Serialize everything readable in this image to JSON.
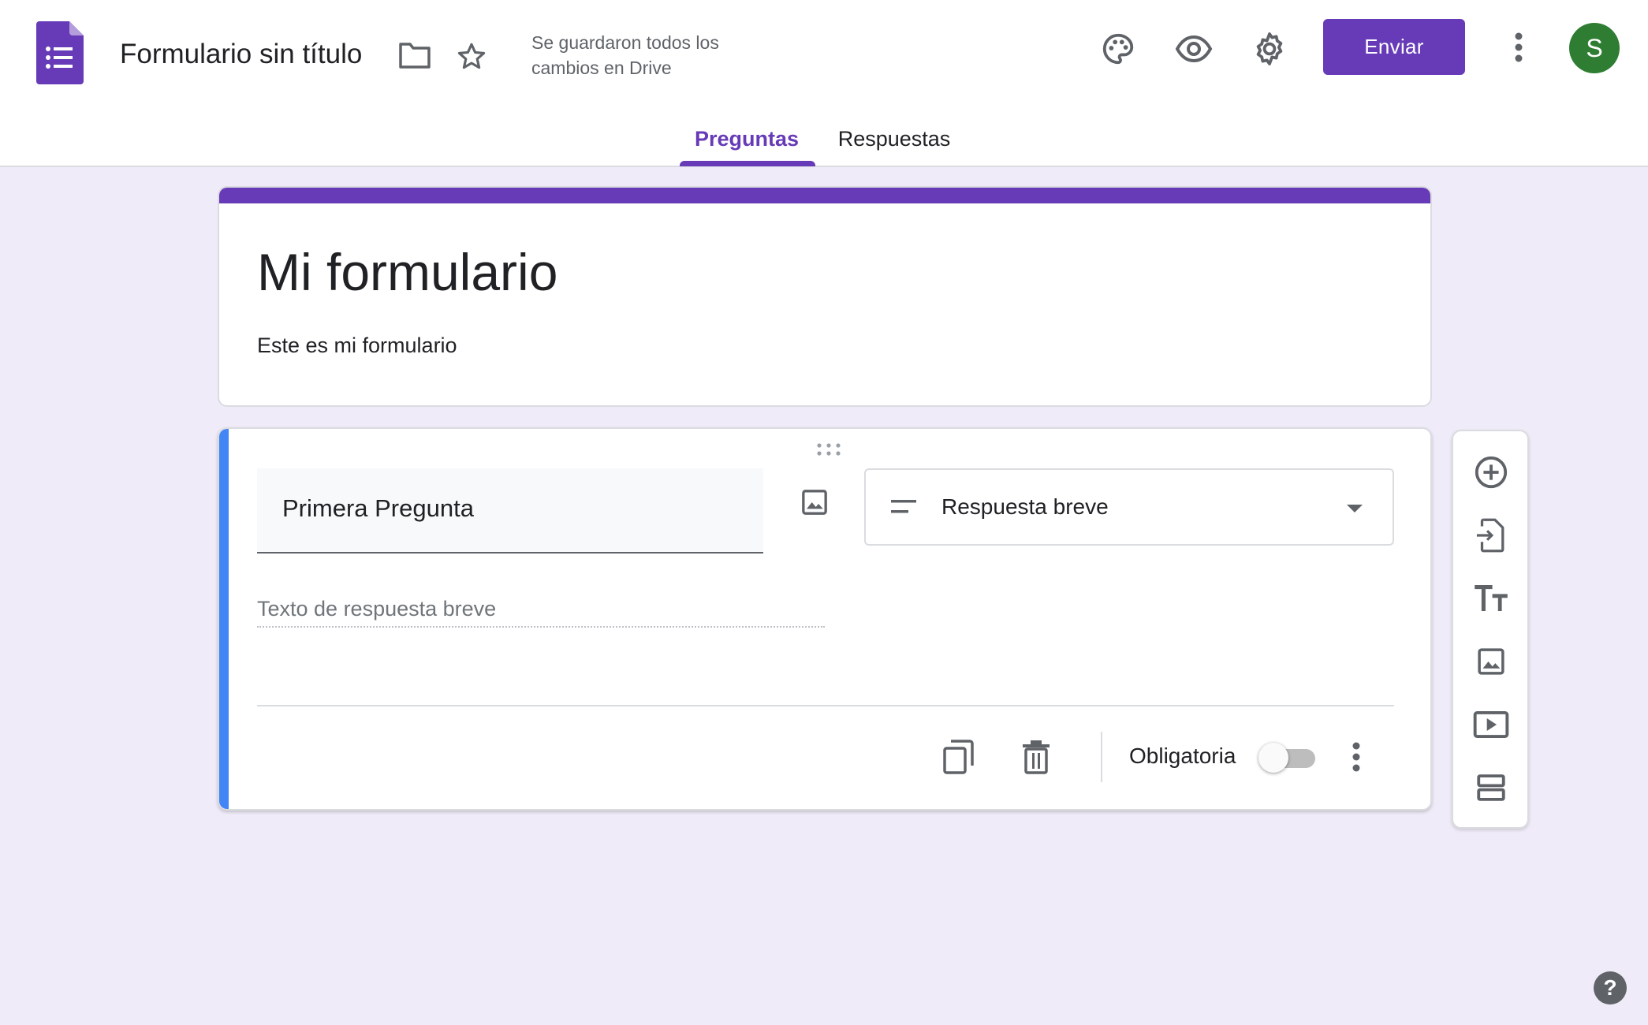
{
  "header": {
    "doc_title": "Formulario sin título",
    "saved_status": "Se guardaron todos los cambios en Drive",
    "send_label": "Enviar",
    "avatar_initial": "S",
    "icons": {
      "app": "google-forms-icon",
      "folder": "folder-icon",
      "star": "star-icon",
      "palette": "palette-icon",
      "preview": "eye-icon",
      "settings": "gear-icon",
      "more": "more-vert-icon"
    }
  },
  "tabs": [
    {
      "label": "Preguntas",
      "active": true
    },
    {
      "label": "Respuestas",
      "active": false
    }
  ],
  "form": {
    "title": "Mi formulario",
    "description": "Este es mi formulario"
  },
  "question": {
    "title": "Primera Pregunta",
    "type_label": "Respuesta breve",
    "answer_placeholder": "Texto de respuesta breve",
    "required_label": "Obligatoria",
    "required": false
  },
  "side_toolbar": {
    "items": [
      "add-question",
      "import-questions",
      "add-title-description",
      "add-image",
      "add-video",
      "add-section"
    ]
  },
  "help_label": "?",
  "colors": {
    "accent": "#673ab7",
    "background": "#f0ebf8",
    "question_accent": "#4285f4",
    "avatar": "#2e7d32"
  }
}
